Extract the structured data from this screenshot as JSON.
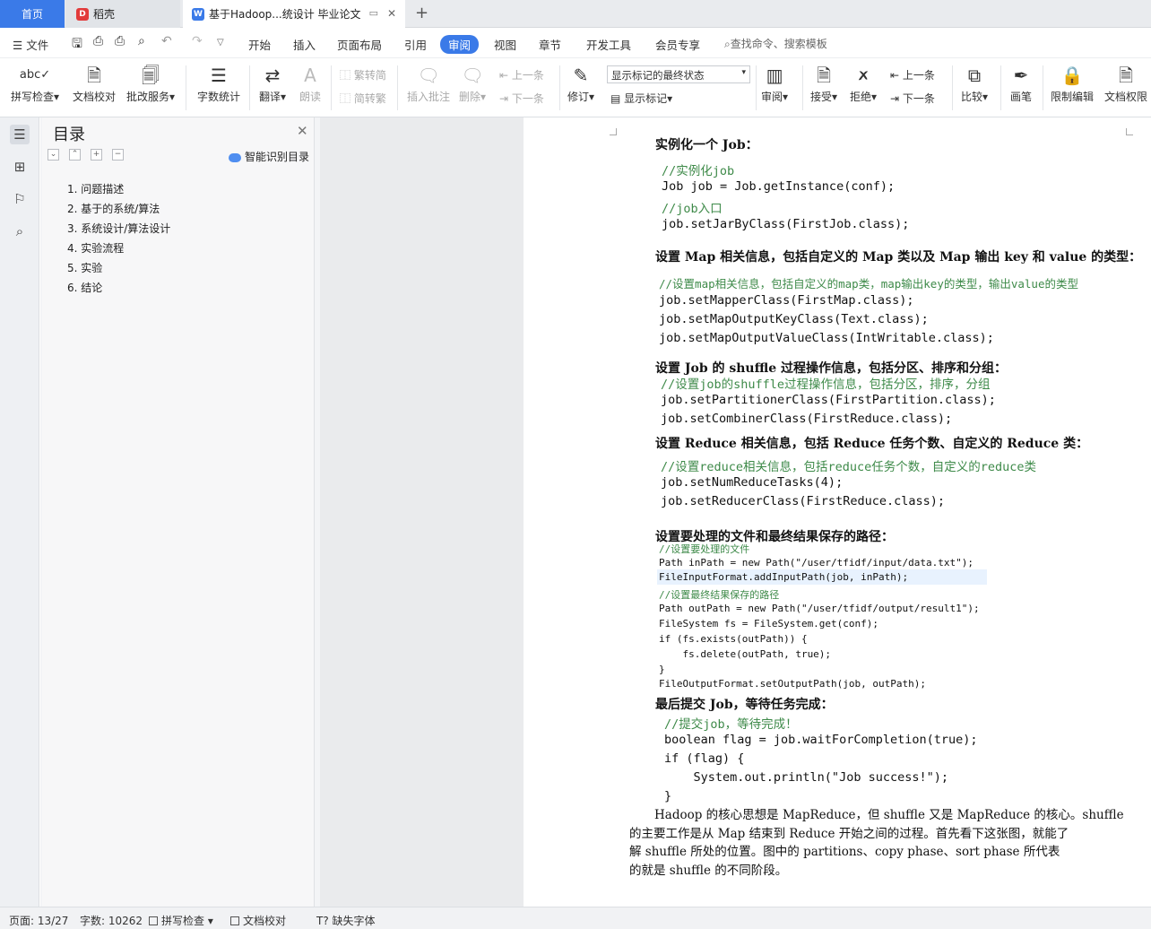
{
  "tabs": {
    "home": "首页",
    "daoke": "稻壳",
    "doc": "基于Hadoop...统设计 毕业论文",
    "new_tab": "+"
  },
  "menubar": {
    "file": "文件",
    "items": [
      "开始",
      "插入",
      "页面布局",
      "引用",
      "审阅",
      "视图",
      "章节",
      "开发工具",
      "会员专享"
    ],
    "active": "审阅",
    "search": "查找命令、搜索模板"
  },
  "ribbon": {
    "spellcheck": "拼写检查",
    "doccheck": "文档校对",
    "proofsvc": "批改服务",
    "wordcount": "字数统计",
    "translate": "翻译",
    "readaloud": "朗读",
    "trad2simp": "繁转简",
    "simp2trad": "简转繁",
    "insert_comment": "插入批注",
    "delete": "删除",
    "prev": "上一条",
    "next": "下一条",
    "track": "修订",
    "mark_state": "显示标记的最终状态",
    "show_marks": "显示标记",
    "review": "审阅",
    "accept": "接受",
    "reject": "拒绝",
    "prev2": "上一条",
    "next2": "下一条",
    "compare": "比较",
    "pen": "画笔",
    "restrict": "限制编辑",
    "perm": "文档权限"
  },
  "toc": {
    "title": "目录",
    "smart": "智能识别目录",
    "items": [
      "1. 问题描述",
      "2. 基于的系统/算法",
      "3. 系统设计/算法设计",
      "4. 实验流程",
      "5. 实验",
      "6. 结论"
    ]
  },
  "doc": {
    "h1": "实例化一个 Job：",
    "c1": [
      "//实例化job",
      "Job job = Job.getInstance(conf);",
      "//job入口",
      "job.setJarByClass(FirstJob.class);"
    ],
    "h2": "设置 Map 相关信息，包括自定义的 Map 类以及 Map 输出 key 和 value 的类型：",
    "c2": [
      "//设置map相关信息，包括自定义的map类，map输出key的类型，输出value的类型",
      "job.setMapperClass(FirstMap.class);",
      "job.setMapOutputKeyClass(Text.class);",
      "job.setMapOutputValueClass(IntWritable.class);"
    ],
    "h3": "设置 Job 的 shuffle 过程操作信息，包括分区、排序和分组：",
    "c3": [
      "//设置job的shuffle过程操作信息，包括分区，排序，分组",
      "job.setPartitionerClass(FirstPartition.class);",
      "job.setCombinerClass(FirstReduce.class);"
    ],
    "h4": "设置 Reduce 相关信息，包括 Reduce 任务个数、自定义的 Reduce 类：",
    "c4": [
      "//设置reduce相关信息，包括reduce任务个数，自定义的reduce类",
      "job.setNumReduceTasks(4);",
      "job.setReducerClass(FirstReduce.class);"
    ],
    "h5": "设置要处理的文件和最终结果保存的路径：",
    "c5": [
      "//设置要处理的文件",
      "Path inPath = new Path(\"/user/tfidf/input/data.txt\");",
      "FileInputFormat.addInputPath(job, inPath);",
      "//设置最终结果保存的路径",
      "Path outPath = new Path(\"/user/tfidf/output/result1\");",
      "FileSystem fs = FileSystem.get(conf);",
      "if (fs.exists(outPath)) {",
      "    fs.delete(outPath, true);",
      "}",
      "FileOutputFormat.setOutputPath(job, outPath);"
    ],
    "h6": "最后提交 Job，等待任务完成：",
    "c6": [
      "//提交job，等待完成！",
      "boolean flag = job.waitForCompletion(true);",
      "if (flag) {",
      "    System.out.println(\"Job success!\");",
      "}"
    ],
    "para": [
      "Hadoop 的核心思想是 MapReduce，但 shuffle 又是 MapReduce 的核心。shuffle",
      "的主要工作是从 Map 结束到 Reduce 开始之间的过程。首先看下这张图，就能了",
      "解 shuffle 所处的位置。图中的 partitions、copy phase、sort phase 所代表",
      "的就是 shuffle 的不同阶段。"
    ]
  },
  "status": {
    "page": "页面: 13/27",
    "words": "字数: 10262",
    "spell": "拼写检查",
    "proof": "文档校对",
    "missing_font": "缺失字体"
  }
}
